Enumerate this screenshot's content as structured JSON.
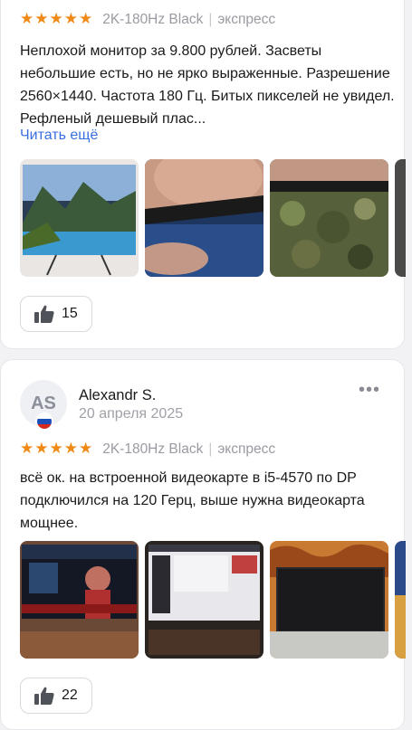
{
  "reviews": [
    {
      "stars": "★★★★★",
      "variant": "2K-180Hz Black",
      "delivery": "экспресс",
      "text": "Неплохой монитор за 9.800 рублей. Засветы небольшие есть, но не ярко выраженные. Разрешение 2560×1440. Частота 180 Гц. Битых пикселей не увидел.  Рефленый дешевый плас...",
      "read_more": "Читать ещё",
      "likes": "15"
    },
    {
      "avatar_initials": "AS",
      "author": "Alexandr S.",
      "date": "20 апреля 2025",
      "more": "•••",
      "stars": "★★★★★",
      "variant": "2K-180Hz Black",
      "delivery": "экспресс",
      "text": "всё ок. на встроенной видеокарте в i5-4570 по DP подключился на 120 Герц, выше нужна видеокарта мощнее.",
      "likes": "22"
    }
  ],
  "icons": {
    "like": "thumbs-up-icon",
    "flag": "russia-flag-icon"
  },
  "colors": {
    "stars": "#f08a16",
    "link": "#3a6fe0",
    "muted": "#9a9aa2"
  }
}
